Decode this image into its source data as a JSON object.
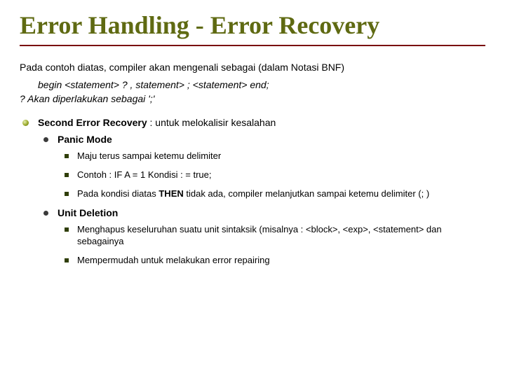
{
  "title": "Error Handling - Error Recovery",
  "intro": "Pada contoh diatas, compiler akan mengenali sebagai (dalam Notasi BNF)",
  "code": "begin  <statement>  ?  ,  statement>  ;  <statement> end;",
  "note": "?  Akan diperlakukan sebagai ';'",
  "bullet1_bold": "Second Error Recovery",
  "bullet1_rest": " : untuk melokalisir kesalahan",
  "panic_label": "Panic Mode",
  "panic_items": {
    "a": "Maju terus sampai ketemu delimiter",
    "b": "Contoh : IF A = 1  Kondisi : = true;",
    "c_pre": "Pada kondisi diatas ",
    "c_bold": "THEN",
    "c_post": "  tidak ada, compiler melanjutkan sampai ketemu delimiter (; )"
  },
  "unit_label": "Unit Deletion",
  "unit_items": {
    "a": "Menghapus keseluruhan suatu unit sintaksik (misalnya : <block>, <exp>, <statement> dan sebagainya",
    "b": "Mempermudah untuk melakukan error repairing"
  }
}
